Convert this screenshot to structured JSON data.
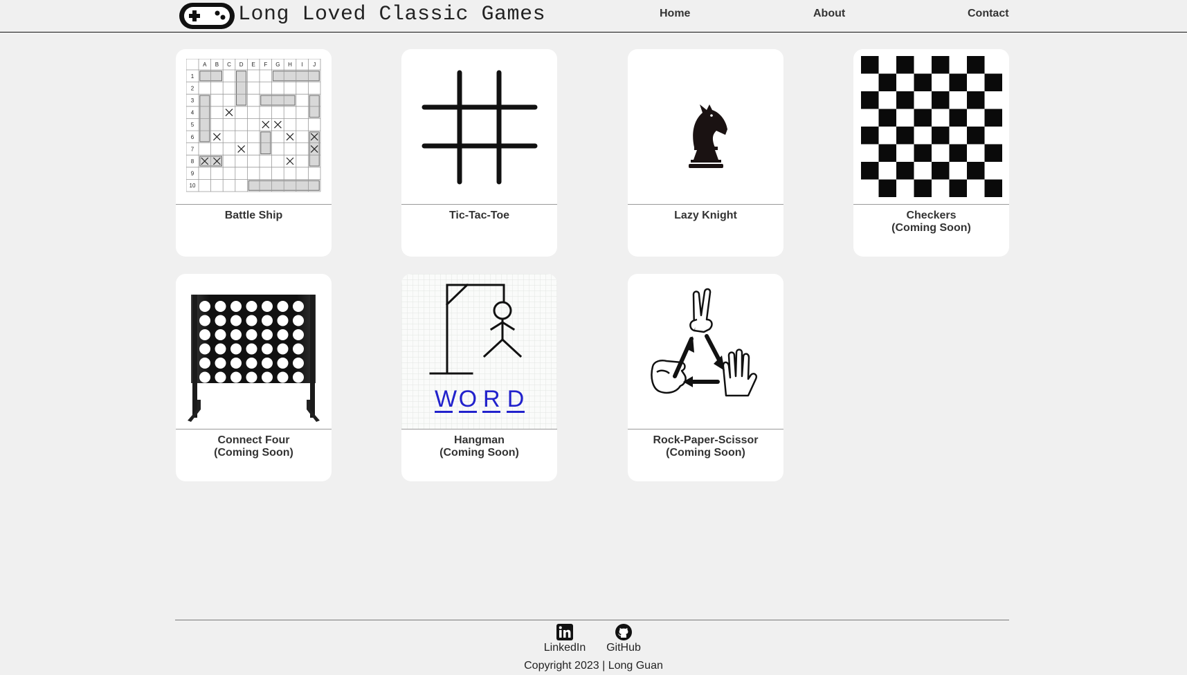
{
  "header": {
    "logo_icon": "gamepad-icon",
    "title": "Long Loved Classic Games",
    "nav": [
      {
        "label": "Home"
      },
      {
        "label": "About"
      },
      {
        "label": "Contact"
      }
    ]
  },
  "games": [
    {
      "title": "Battle Ship",
      "status": "",
      "icon": "battleship-grid-icon"
    },
    {
      "title": "Tic-Tac-Toe",
      "status": "",
      "icon": "tic-tac-toe-grid-icon"
    },
    {
      "title": "Lazy Knight",
      "status": "",
      "icon": "chess-knight-icon"
    },
    {
      "title": "Checkers",
      "status": "(Coming Soon)",
      "icon": "checkerboard-icon"
    },
    {
      "title": "Connect Four",
      "status": "(Coming Soon)",
      "icon": "connect-four-board-icon"
    },
    {
      "title": "Hangman",
      "status": "(Coming Soon)",
      "icon": "hangman-gallows-icon",
      "word_letters": [
        "W",
        "O",
        "R",
        "D"
      ]
    },
    {
      "title": "Rock-Paper-Scissor",
      "status": "(Coming Soon)",
      "icon": "rock-paper-scissors-cycle-icon"
    }
  ],
  "battleship": {
    "columns": [
      "A",
      "B",
      "C",
      "D",
      "E",
      "F",
      "G",
      "H",
      "I",
      "J"
    ],
    "rows": [
      "1",
      "2",
      "3",
      "4",
      "5",
      "6",
      "7",
      "8",
      "9",
      "10"
    ]
  },
  "footer": {
    "links": [
      {
        "label": "LinkedIn",
        "icon": "linkedin-icon"
      },
      {
        "label": "GitHub",
        "icon": "github-icon"
      }
    ],
    "copyright": "Copyright 2023 | Long Guan"
  },
  "colors": {
    "background": "#f0f0f0",
    "card": "#ffffff",
    "text": "#333333",
    "hangman_word": "#2222cc"
  }
}
